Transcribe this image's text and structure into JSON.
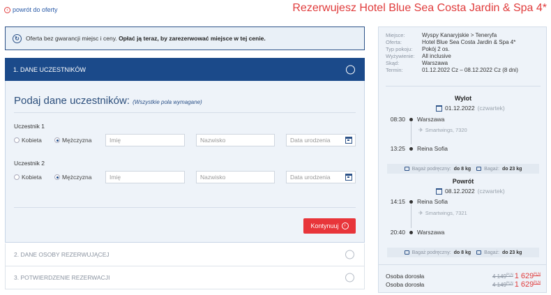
{
  "header": {
    "back_label": "powrót do oferty",
    "title": "Rezerwujesz Hotel Blue Sea Costa Jardin & Spa 4*"
  },
  "notice": {
    "text": "Oferta bez gwarancji miejsc i ceny. ",
    "bold": "Opłać ją teraz, by zarezerwować miejsce w tej cenie."
  },
  "steps": [
    {
      "label": "1. DANE UCZESTNIKÓW"
    },
    {
      "label": "2. DANE OSOBY REZERWUJĄCEJ"
    },
    {
      "label": "3. POTWIERDZENIE REZERWACJI"
    }
  ],
  "form": {
    "heading": "Podaj dane uczestników:",
    "note": "(Wszystkie pola wymagane)",
    "participants": [
      {
        "label": "Uczestnik 1",
        "female": "Kobieta",
        "male": "Mężczyzna",
        "selected": "male",
        "first_name_placeholder": "Imię",
        "last_name_placeholder": "Nazwisko",
        "dob_placeholder": "Data urodzenia"
      },
      {
        "label": "Uczestnik 2",
        "female": "Kobieta",
        "male": "Mężczyzna",
        "selected": "male",
        "first_name_placeholder": "Imię",
        "last_name_placeholder": "Nazwisko",
        "dob_placeholder": "Data urodzenia"
      }
    ],
    "continue_label": "Kontynuuj"
  },
  "summary": {
    "info": [
      {
        "key": "Miejsce:",
        "value": "Wyspy Kanaryjskie > Teneryfa"
      },
      {
        "key": "Oferta:",
        "value": "Hotel Blue Sea Costa Jardin & Spa 4*"
      },
      {
        "key": "Typ pokoju:",
        "value": "Pokój 2 os."
      },
      {
        "key": "Wyżywienie:",
        "value": "All inclusive"
      },
      {
        "key": "Skąd:",
        "value": "Warszawa"
      },
      {
        "key": "Termin:",
        "value": "01.12.2022 Cz – 08.12.2022 Cz (8 dni)"
      }
    ],
    "outbound": {
      "title": "Wylot",
      "date": "01.12.2022",
      "dow": "(czwartek)",
      "dep_time": "08:30",
      "dep_place": "Warszawa",
      "carrier": "Smartwings, 7320",
      "arr_time": "13:25",
      "arr_place": "Reina Sofia"
    },
    "return": {
      "title": "Powrót",
      "date": "08.12.2022",
      "dow": "(czwartek)",
      "dep_time": "14:15",
      "dep_place": "Reina Sofia",
      "carrier": "Smartwings, 7321",
      "arr_time": "20:40",
      "arr_place": "Warszawa"
    },
    "baggage": {
      "hand_label": "Bagaż podręczny:",
      "hand_value": "do 8 kg",
      "hold_label": "Bagaż:",
      "hold_value": "do 23 kg"
    },
    "prices": [
      {
        "label": "Osoba dorosła",
        "old": "4 149",
        "old_cents": "PLN",
        "new": "1 629",
        "new_cents": "PLN"
      },
      {
        "label": "Osoba dorosła",
        "old": "4 149",
        "old_cents": "PLN",
        "new": "1 629",
        "new_cents": "PLN"
      }
    ]
  }
}
